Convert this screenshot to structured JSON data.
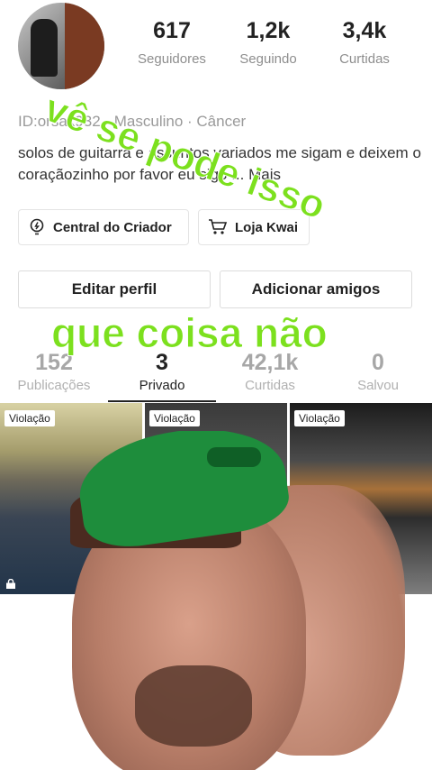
{
  "profile": {
    "stats": [
      {
        "value": "617",
        "label": "Seguidores"
      },
      {
        "value": "1,2k",
        "label": "Seguindo"
      },
      {
        "value": "3,4k",
        "label": "Curtidas"
      }
    ],
    "meta": "ID:orsax932 · Masculino · Câncer",
    "bio": "solos de guitarra e assuntos variados me sigam e deixem o coraçãozinho por favor eu sigo ...",
    "bio_more": "Mais"
  },
  "shortcuts": {
    "creator_label": "Central do Criador",
    "shop_label": "Loja Kwai"
  },
  "actions": {
    "edit_label": "Editar perfil",
    "add_friends_label": "Adicionar amigos"
  },
  "tabs": [
    {
      "count": "152",
      "label": "Publicações"
    },
    {
      "count": "3",
      "label": "Privado"
    },
    {
      "count": "42,1k",
      "label": "Curtidas"
    },
    {
      "count": "0",
      "label": "Salvou"
    }
  ],
  "videos": [
    {
      "badge": "Violação"
    },
    {
      "badge": "Violação"
    },
    {
      "badge": "Violação"
    }
  ],
  "overlay": {
    "caption_top": "vê se pode isso",
    "caption_middle": "que coisa não"
  },
  "colors": {
    "accent_green": "#7ce01e",
    "cap_green": "#1e8d3c"
  }
}
